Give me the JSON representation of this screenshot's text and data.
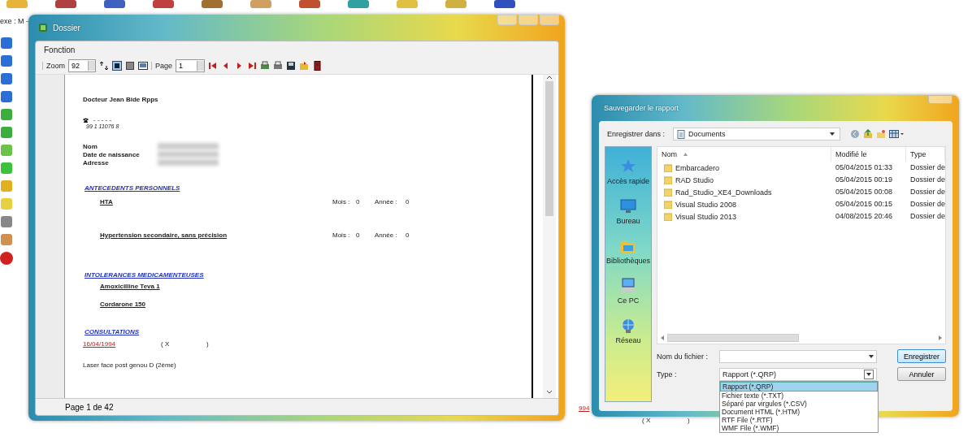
{
  "background_app": {
    "caption": "exe : M -",
    "fragments": [
      {
        "text": "994",
        "kind": "date"
      },
      {
        "text": "( X",
        "kind": "plain"
      },
      {
        "text": ")",
        "kind": "plain"
      }
    ]
  },
  "report_window": {
    "title": "Dossier",
    "menu": [
      "Fonction"
    ],
    "toolbar": {
      "zoom_label": "Zoom",
      "zoom_value": "92",
      "page_label": "Page",
      "page_value": "1"
    },
    "document": {
      "doctor": "Docteur Jean Bide Rpps",
      "phone_dots": "- - - - -",
      "phone_number": "99 1 11076 8",
      "identity_labels": [
        "Nom",
        "Date de naissance",
        "Adresse"
      ],
      "sections": [
        {
          "heading": "ANTECEDENTS PERSONNELS",
          "kind": "history",
          "items": [
            {
              "name": "HTA",
              "month_label": "Mois :",
              "month": "0",
              "year_label": "Année :",
              "year": "0"
            },
            {
              "name": "Hypertension secondaire, sans précision",
              "month_label": "Mois :",
              "month": "0",
              "year_label": "Année :",
              "year": "0"
            }
          ]
        },
        {
          "heading": "INTOLERANCES MEDICAMENTEUSES",
          "kind": "list",
          "items": [
            {
              "name": "Amoxicilline Teva 1"
            },
            {
              "name": "Cordarone 150"
            }
          ]
        },
        {
          "heading": "CONSULTATIONS",
          "kind": "consultation",
          "items": [
            {
              "date": "16/04/1994",
              "open": "( X",
              "close": ")",
              "note": "Laser face post genou D (2ème)"
            }
          ]
        }
      ]
    },
    "status": "Page 1 de 42"
  },
  "save_dialog": {
    "title": "Sauvegarder le rapport",
    "save_in_label": "Enregistrer dans :",
    "save_in_value": "Documents",
    "places": [
      "Accès rapide",
      "Bureau",
      "Bibliothèques",
      "Ce PC",
      "Réseau"
    ],
    "columns": [
      "Nom",
      "Modifié le",
      "Type"
    ],
    "rows": [
      {
        "name": "Embarcadero",
        "modified": "05/04/2015 01:33",
        "type": "Dossier de"
      },
      {
        "name": "RAD Studio",
        "modified": "05/04/2015 00:19",
        "type": "Dossier de"
      },
      {
        "name": "Rad_Studio_XE4_Downloads",
        "modified": "05/04/2015 00:08",
        "type": "Dossier de"
      },
      {
        "name": "Visual Studio 2008",
        "modified": "05/04/2015 00:15",
        "type": "Dossier de"
      },
      {
        "name": "Visual Studio 2013",
        "modified": "04/08/2015 20:46",
        "type": "Dossier de"
      }
    ],
    "filename_label": "Nom du fichier :",
    "type_label": "Type :",
    "type_value": "Rapport (*.QRP)",
    "type_options": [
      {
        "label": "Rapport (*.QRP)",
        "selected": true
      },
      {
        "label": "Fichier texte (*.TXT)",
        "selected": false
      },
      {
        "label": "Séparé par virgules (*.CSV)",
        "selected": false
      },
      {
        "label": "Document HTML (*.HTM)",
        "selected": false
      },
      {
        "label": "RTF File (*.RTF)",
        "selected": false
      },
      {
        "label": "WMF File (*.WMF)",
        "selected": false
      }
    ],
    "buttons": [
      "Enregistrer",
      "Annuler"
    ]
  }
}
